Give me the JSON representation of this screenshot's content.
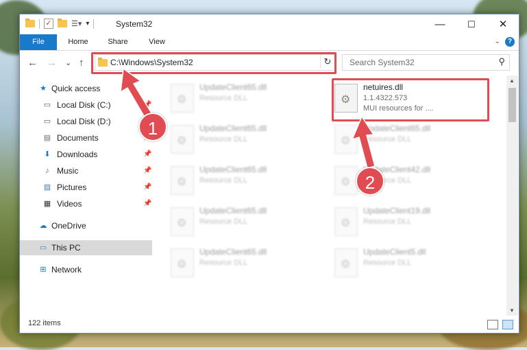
{
  "window": {
    "title": "System32",
    "minimize_glyph": "—",
    "maximize_glyph": "☐",
    "close_glyph": "✕"
  },
  "ribbon": {
    "tabs": [
      "File",
      "Home",
      "Share",
      "View"
    ],
    "help_glyph": "?",
    "expand_glyph": "⌄"
  },
  "nav": {
    "back_glyph": "←",
    "forward_glyph": "→",
    "recent_glyph": "⌄",
    "up_glyph": "↑",
    "address": "C:\\Windows\\System32",
    "address_dropdown_glyph": "⌄",
    "refresh_glyph": "↻",
    "search_placeholder": "Search System32",
    "search_glyph": "⚲"
  },
  "sidebar": {
    "items": [
      {
        "label": "Quick access",
        "icon": "star-icon",
        "glyph": "★",
        "color": "#1979ca"
      },
      {
        "label": "Local Disk (C:)",
        "icon": "drive-icon",
        "glyph": "▭",
        "color": "#555555",
        "pin": "📌"
      },
      {
        "label": "Local Disk (D:)",
        "icon": "drive-icon",
        "glyph": "▭",
        "color": "#555555"
      },
      {
        "label": "Documents",
        "icon": "documents-icon",
        "glyph": "▤",
        "color": "#6d6d6d",
        "pin": "📌"
      },
      {
        "label": "Downloads",
        "icon": "downloads-icon",
        "glyph": "⬇",
        "color": "#1979ca",
        "pin": "📌"
      },
      {
        "label": "Music",
        "icon": "music-icon",
        "glyph": "♪",
        "color": "#1979ca",
        "pin": "📌"
      },
      {
        "label": "Pictures",
        "icon": "pictures-icon",
        "glyph": "▨",
        "color": "#4a7fa8",
        "pin": "📌"
      },
      {
        "label": "Videos",
        "icon": "videos-icon",
        "glyph": "▦",
        "color": "#333333",
        "pin": "📌"
      },
      {
        "label": "OneDrive",
        "icon": "cloud-icon",
        "glyph": "☁",
        "color": "#1979ca"
      },
      {
        "label": "This PC",
        "icon": "computer-icon",
        "glyph": "▭",
        "color": "#4a7fa8"
      },
      {
        "label": "Network",
        "icon": "network-icon",
        "glyph": "⊞",
        "color": "#1979ca"
      }
    ]
  },
  "files": {
    "highlighted": {
      "name": "netuires.dll",
      "version": "1.1.4322.573",
      "description": "MUI resources for ...."
    },
    "left_column": [
      {
        "name": "UpdateClient65.dll",
        "type": "Resource DLL"
      },
      {
        "name": "UpdateClient65.dll",
        "type": "Resource DLL"
      },
      {
        "name": "UpdateClient65.dll",
        "type": "Resource DLL"
      },
      {
        "name": "UpdateClient65.dll",
        "type": "Resource DLL"
      },
      {
        "name": "UpdateClient65.dll",
        "type": "Resource DLL"
      }
    ],
    "right_column": [
      {
        "name": "UpdateClient65.dll",
        "type": "Resource DLL"
      },
      {
        "name": "UpdateClient42.dll",
        "type": "Resource DLL"
      },
      {
        "name": "UpdateClient19.dll",
        "type": "Resource DLL"
      },
      {
        "name": "UpdateClient5.dll",
        "type": "Resource DLL"
      }
    ]
  },
  "status": {
    "item_count": "122 items"
  },
  "annotations": {
    "step1": "1",
    "step2": "2",
    "color": "#e14b52"
  }
}
